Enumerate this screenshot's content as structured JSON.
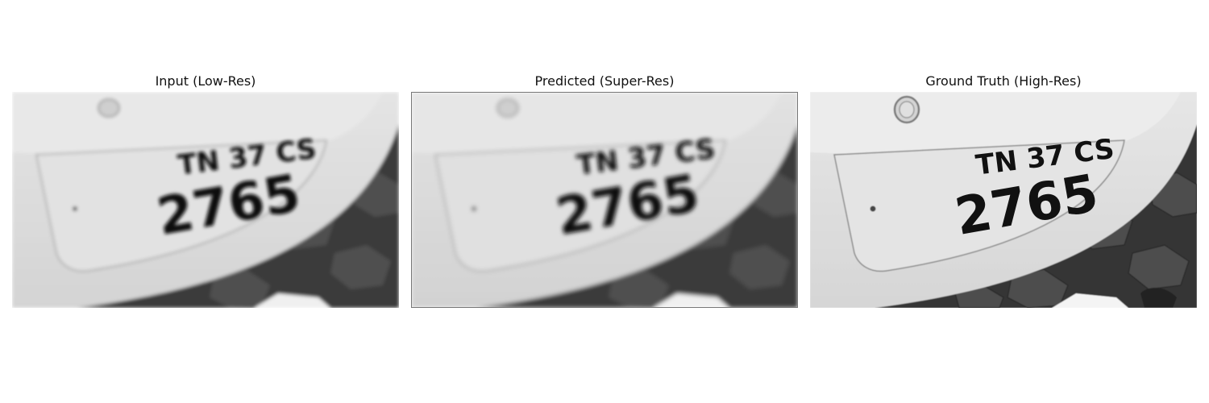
{
  "panels": [
    {
      "title": "Input (Low-Res)",
      "plate_line1": "TN 37 CS",
      "plate_line2": "2765",
      "quality": "low"
    },
    {
      "title": "Predicted (Super-Res)",
      "plate_line1": "TN 37 CS",
      "plate_line2": "2765",
      "quality": "medium"
    },
    {
      "title": "Ground Truth (High-Res)",
      "plate_line1": "TN 37 CS",
      "plate_line2": "2765",
      "quality": "high"
    }
  ]
}
